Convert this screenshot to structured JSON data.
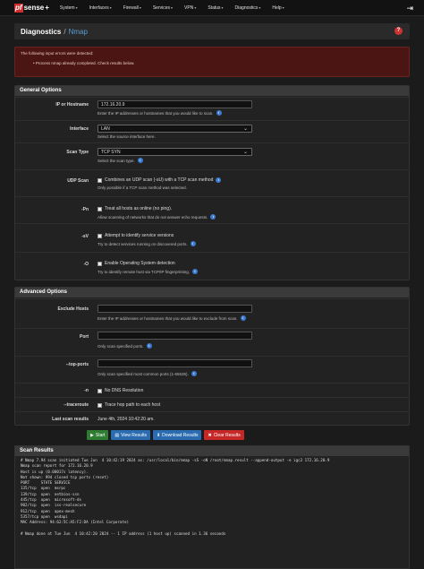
{
  "nav": {
    "logo_pf": "pf",
    "logo_sense": "sense",
    "logo_plus": "+",
    "items": [
      {
        "label": "System"
      },
      {
        "label": "Interfaces"
      },
      {
        "label": "Firewall"
      },
      {
        "label": "Services"
      },
      {
        "label": "VPN"
      },
      {
        "label": "Status"
      },
      {
        "label": "Diagnostics"
      },
      {
        "label": "Help"
      }
    ]
  },
  "breadcrumb": {
    "section": "Diagnostics",
    "separator": "/",
    "page": "Nmap"
  },
  "alert": {
    "title": "The following input errors were detected:",
    "items": [
      "Process nmap already completed. Check results below."
    ]
  },
  "general": {
    "title": "General Options",
    "ip_label": "IP or Hostname",
    "ip_value": "172.16.20.9",
    "ip_hint": "Enter the IP addresses or hostnames that you would like to scan.",
    "iface_label": "Interface",
    "iface_value": "LAN",
    "iface_hint": "Select the source interface here.",
    "scan_label": "Scan Type",
    "scan_value": "TCP SYN",
    "scan_hint": "Select the scan type.",
    "udp_label": "UDP Scan",
    "udp_check": "Combines an UDP scan (-sU) with a TCP scan method",
    "udp_hint": "Only possible if a TCP scan method was selected.",
    "pn_label": "-Pn",
    "pn_check": "Treat all hosts as online (no ping).",
    "pn_hint": "Allow scanning of networks that do not answer echo requests.",
    "sv_label": "-sV",
    "sv_check": "Attempt to identify service versions",
    "sv_hint": "Try to detect services running on discovered ports.",
    "o_label": "-O",
    "o_check": "Enable Operating System detection",
    "o_hint": "Try to identify remote host via TCP/IP fingerprinting."
  },
  "advanced": {
    "title": "Advanced Options",
    "exclude_label": "Exclude Hosts",
    "exclude_hint": "Enter the IP addresses or hostnames that you would like to exclude from scan.",
    "port_label": "Port",
    "port_hint": "Only scan specified ports.",
    "top_label": "--top-ports",
    "top_hint": "Only scan specified most common ports (1-65535).",
    "n_label": "-n",
    "n_check": "No DNS Resolution",
    "trace_label": "--traceroute",
    "trace_check": "Trace hop path to each host",
    "last_label": "Last scan results",
    "last_value": "June 4th, 2024 10:42:20 am."
  },
  "buttons": {
    "start": "Start",
    "view": "View Results",
    "download": "Download Results",
    "clear": "Clear Results"
  },
  "results": {
    "title": "Scan Results",
    "text": "# Nmap 7.94 scan initiated Tue Jun  4 10:42:19 2024 as: /usr/local/bin/nmap -sS -oN /root/nmap.result --append-output -e igc2 172.16.20.9\nNmap scan report for 172.16.20.9\nHost is up (0.00017s latency).\nNot shown: 994 closed tcp ports (reset)\nPORT     STATE SERVICE\n135/tcp  open  msrpc\n139/tcp  open  netbios-ssn\n445/tcp  open  microsoft-ds\n902/tcp  open  iss-realsecure\n912/tcp  open  apex-mesh\n5357/tcp open  wsdapi\nMAC Address: 94:62:5C:A5:F2:DA (Intel Corporate)\n\n# Nmap done at Tue Jun  4 10:42:20 2024 -- 1 IP address (1 host up) scanned in 1.36 seconds"
  }
}
